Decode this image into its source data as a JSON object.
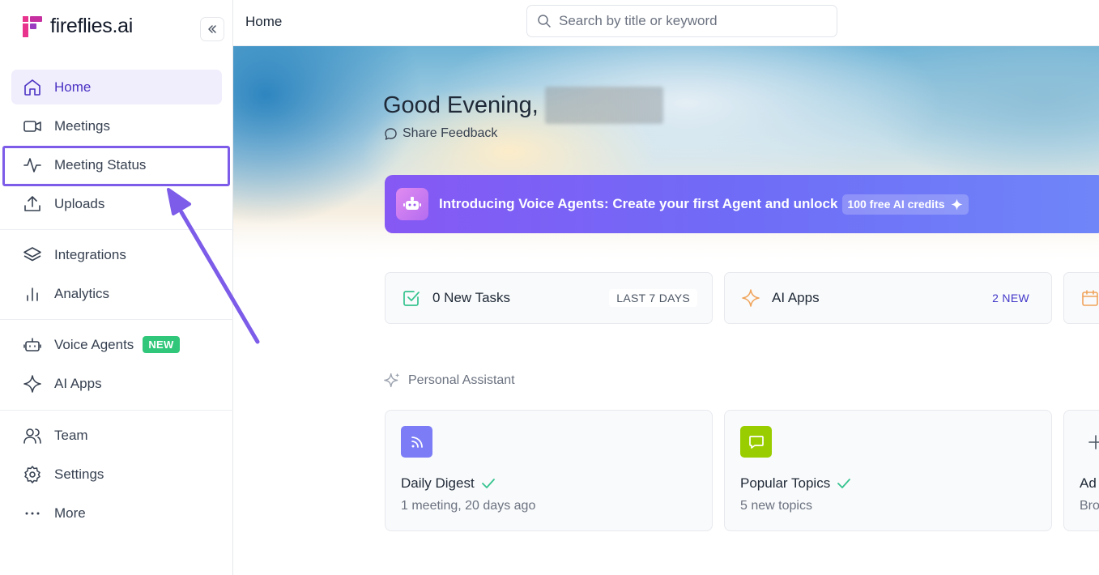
{
  "app": {
    "logo_text": "fireflies.ai"
  },
  "sidebar": {
    "items": [
      {
        "label": "Home",
        "icon": "home-icon"
      },
      {
        "label": "Meetings",
        "icon": "video-icon"
      },
      {
        "label": "Meeting Status",
        "icon": "activity-icon"
      },
      {
        "label": "Uploads",
        "icon": "upload-icon"
      },
      {
        "label": "Integrations",
        "icon": "layers-icon"
      },
      {
        "label": "Analytics",
        "icon": "bar-chart-icon"
      },
      {
        "label": "Voice Agents",
        "icon": "robot-icon",
        "badge": "NEW"
      },
      {
        "label": "AI Apps",
        "icon": "sparkle-icon"
      },
      {
        "label": "Team",
        "icon": "users-icon"
      },
      {
        "label": "Settings",
        "icon": "gear-icon"
      },
      {
        "label": "More",
        "icon": "more-dots-icon"
      }
    ]
  },
  "topbar": {
    "breadcrumb": "Home",
    "search_placeholder": "Search by title or keyword"
  },
  "hero": {
    "greeting": "Good Evening,",
    "feedback_label": "Share Feedback"
  },
  "promo": {
    "text": "Introducing Voice Agents: Create your first Agent and unlock",
    "pill": "100 free AI credits"
  },
  "stats": [
    {
      "title": "0 New Tasks",
      "tag": "LAST 7 DAYS"
    },
    {
      "title": "AI Apps",
      "tag": "2 NEW"
    }
  ],
  "assistant": {
    "title": "Personal Assistant",
    "cards": [
      {
        "title": "Daily Digest",
        "subtitle": "1 meeting, 20 days ago"
      },
      {
        "title": "Popular Topics",
        "subtitle": "5 new topics"
      },
      {
        "title": "Ad",
        "subtitle": "Bro"
      }
    ]
  },
  "colors": {
    "accent": "#4b32c3",
    "highlight": "#7c5ce8",
    "badge_green": "#31c77a",
    "promo_start": "#8658f4",
    "promo_end": "#6f86f8"
  }
}
